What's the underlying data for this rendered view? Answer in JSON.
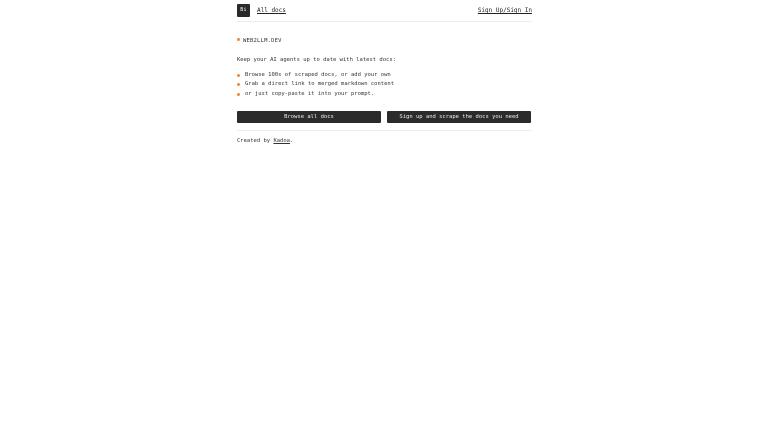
{
  "header": {
    "logo_text": "Bi",
    "all_docs_label": "All docs",
    "sign_label": "Sign Up/Sign In"
  },
  "brand": {
    "name": "WEB2LLM.DEV"
  },
  "intro": "Keep your AI agents up to date with latest docs:",
  "features": [
    "Browse 100s of scraped docs, or add your own",
    "Grab a direct link to merged markdown content",
    "or just copy-paste it into your prompt."
  ],
  "buttons": {
    "browse_label": "Browse all docs",
    "signup_label": "Sign up and scrape the docs you need"
  },
  "credit": {
    "prefix": "Created by ",
    "author": "Kadoa",
    "suffix": "."
  },
  "colors": {
    "accent": "#f08a3c",
    "button_bg": "#2b2b2b",
    "text": "#2b2b2b"
  }
}
